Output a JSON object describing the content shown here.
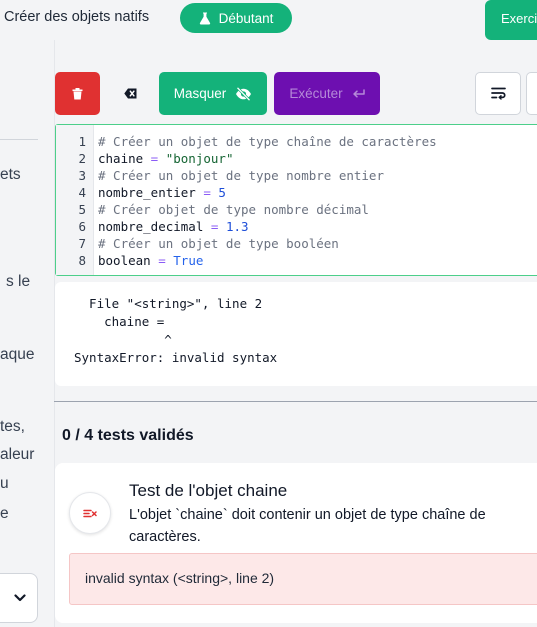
{
  "header": {
    "breadcrumb": "Créer des objets natifs",
    "level_badge": "Débutant",
    "exercise_button": "Exercice"
  },
  "sidebar_fragments": [
    "ets",
    "s le",
    "aque",
    "tes,",
    "aleur",
    "u",
    "e"
  ],
  "toolbar": {
    "hide_label": "Masquer",
    "run_label": "Exécuter"
  },
  "editor": {
    "line_numbers": [
      "1",
      "2",
      "3",
      "4",
      "5",
      "6",
      "7",
      "8"
    ],
    "lines": [
      {
        "comment": "# Créer un objet de type chaîne de caractères"
      },
      {
        "name": "chaine",
        "op": " = ",
        "value": "\"bonjour\"",
        "kind": "string"
      },
      {
        "comment": "# Créer un objet de type nombre entier"
      },
      {
        "name": "nombre_entier",
        "op": " = ",
        "value": "5",
        "kind": "number"
      },
      {
        "comment": "# Créer objet de type nombre décimal"
      },
      {
        "name": "nombre_decimal",
        "op": " = ",
        "value": "1.3",
        "kind": "number"
      },
      {
        "comment": "# Créer un objet de type booléen"
      },
      {
        "name": "boolean",
        "op": " = ",
        "value": "True",
        "kind": "const"
      }
    ]
  },
  "output": {
    "lines": [
      "  File \"<string>\", line 2",
      "    chaine =",
      "            ^",
      "SyntaxError: invalid syntax"
    ]
  },
  "tests": {
    "summary": "0 / 4 tests validés",
    "items": [
      {
        "title": "Test de l'objet chaine",
        "description": "L'objet `chaine` doit contenir un objet de type chaîne de caractères.",
        "error": "invalid syntax (<string>, line 2)"
      }
    ]
  },
  "colors": {
    "success_green": "#14b27a",
    "danger_red": "#e03131",
    "run_purple": "#6d0fb0",
    "error_bg": "#fde8e8"
  },
  "icons": {
    "level": "flask-icon",
    "delete": "trash-icon",
    "clear": "backspace-icon",
    "hide": "eye-off-icon",
    "run": "enter-arrow-icon",
    "wrap": "wrap-lines-icon",
    "test_status": "test-fail-icon",
    "select": "chevron-down-icon"
  }
}
